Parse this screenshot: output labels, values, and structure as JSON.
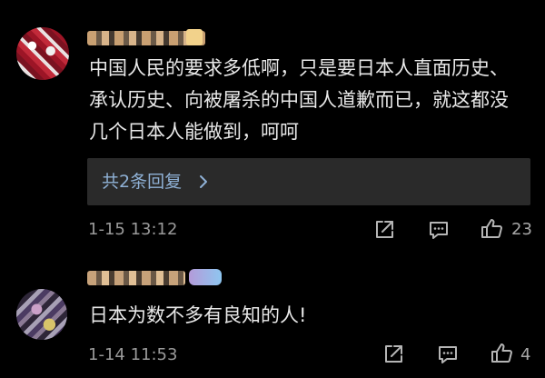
{
  "comments": [
    {
      "text": "中国人民的要求多低啊，只是要日本人直面历史、承认历史、向被屠杀的中国人道歉而已，就这都没几个日本人能做到，呵呵",
      "replies_label": "共2条回复",
      "timestamp": "1-15 13:12",
      "like_count": "23",
      "icons": [
        "share-icon",
        "comment-icon",
        "like-icon",
        "chevron-right-icon"
      ]
    },
    {
      "text": "日本为数不多有良知的人!",
      "timestamp": "1-14 11:53",
      "like_count": "4",
      "icons": [
        "share-icon",
        "comment-icon",
        "like-icon"
      ]
    }
  ],
  "colors": {
    "background": "#000000",
    "text": "#e8e8e8",
    "meta": "#9a9a9a",
    "reply_link": "#8fb1d6",
    "reply_box": "#2a2a2a"
  }
}
